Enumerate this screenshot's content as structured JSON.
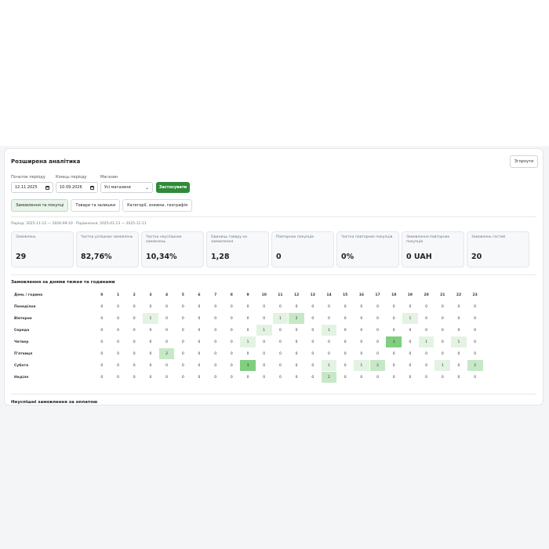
{
  "panel": {
    "title": "Розширена аналітика",
    "collapse_label": "Згорнути"
  },
  "filters": {
    "start_label": "Початок періоду",
    "start_value": "12.11.2025",
    "end_label": "Кінець періоду",
    "end_value": "10.09.2026",
    "store_label": "Магазин",
    "store_value": "Усі магазини",
    "apply_label": "Застосувати"
  },
  "tabs": [
    {
      "label": "Замовлення та покупці",
      "active": true
    },
    {
      "label": "Товари та залишки",
      "active": false
    },
    {
      "label": "Категорії, знижки, географія",
      "active": false
    }
  ],
  "period_text": "Період: 2025-11-12 — 2026-09-10 · Порівняння: 2025-01-13 — 2025-11-11",
  "cards": [
    {
      "label": "Замовлень",
      "value": "29"
    },
    {
      "label": "Частка успішних замовлень",
      "value": "82,76%"
    },
    {
      "label": "Частка неуспішних замовлень",
      "value": "10,34%"
    },
    {
      "label": "Одиниць товару на замовлення",
      "value": "1,28"
    },
    {
      "label": "Повторних покупців",
      "value": "0"
    },
    {
      "label": "Частка повторних покупців",
      "value": "0%"
    },
    {
      "label": "Замовлення повторних покупців",
      "value": "0 UAH"
    },
    {
      "label": "Замовлень гостей",
      "value": "20"
    }
  ],
  "heatmap": {
    "title": "Замовлення за днями тижня та годинами",
    "corner": "День / година",
    "hours": [
      "0",
      "1",
      "2",
      "3",
      "4",
      "5",
      "6",
      "7",
      "8",
      "9",
      "10",
      "11",
      "12",
      "13",
      "14",
      "15",
      "16",
      "17",
      "18",
      "19",
      "20",
      "21",
      "22",
      "23"
    ],
    "rows": [
      {
        "day": "Понеділок",
        "values": [
          0,
          0,
          0,
          0,
          0,
          0,
          0,
          0,
          0,
          0,
          0,
          0,
          0,
          0,
          0,
          0,
          0,
          0,
          0,
          0,
          0,
          0,
          0,
          0
        ]
      },
      {
        "day": "Вівторок",
        "values": [
          0,
          0,
          0,
          1,
          0,
          0,
          0,
          0,
          0,
          0,
          0,
          1,
          2,
          0,
          0,
          0,
          0,
          0,
          0,
          1,
          0,
          0,
          0,
          0
        ]
      },
      {
        "day": "Середа",
        "values": [
          0,
          0,
          0,
          0,
          0,
          0,
          0,
          0,
          0,
          0,
          1,
          0,
          0,
          0,
          1,
          0,
          0,
          0,
          0,
          0,
          0,
          0,
          0,
          0
        ]
      },
      {
        "day": "Четвер",
        "values": [
          0,
          0,
          0,
          0,
          0,
          0,
          0,
          0,
          0,
          1,
          0,
          0,
          0,
          0,
          0,
          0,
          0,
          0,
          3,
          0,
          1,
          0,
          1,
          0
        ]
      },
      {
        "day": "П'ятниця",
        "values": [
          0,
          0,
          0,
          0,
          2,
          0,
          0,
          0,
          0,
          0,
          0,
          0,
          0,
          0,
          0,
          0,
          0,
          0,
          0,
          0,
          0,
          0,
          0,
          0
        ]
      },
      {
        "day": "Субота",
        "values": [
          0,
          0,
          0,
          0,
          0,
          0,
          0,
          0,
          0,
          3,
          0,
          0,
          0,
          0,
          1,
          0,
          1,
          2,
          0,
          0,
          0,
          1,
          0,
          2
        ]
      },
      {
        "day": "Неділя",
        "values": [
          0,
          0,
          0,
          0,
          0,
          0,
          0,
          0,
          0,
          0,
          0,
          0,
          0,
          0,
          2,
          0,
          0,
          0,
          0,
          0,
          0,
          0,
          0,
          0
        ]
      }
    ]
  },
  "next_section_title": "Неуспішні замовлення за оплатою",
  "colors": {
    "accent": "#2f8a3a",
    "heat_1": "#e3f3e3",
    "heat_2": "#c7e8c7",
    "heat_3": "#7fcf7f"
  }
}
